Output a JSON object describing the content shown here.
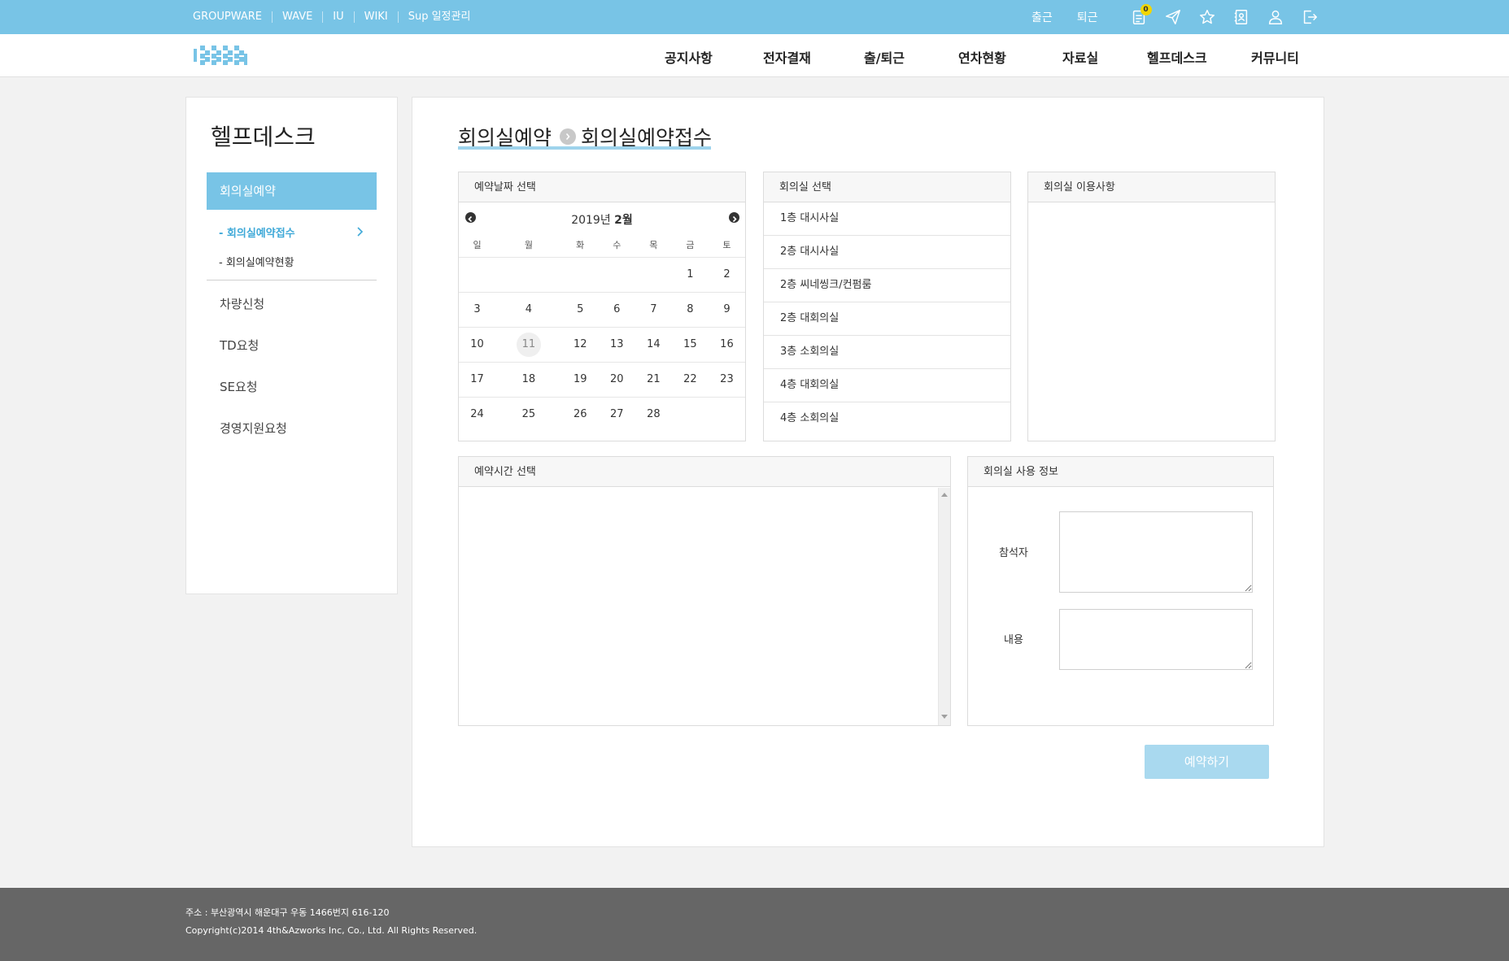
{
  "topbar": {
    "links": [
      "GROUPWARE",
      "WAVE",
      "IU",
      "WIKI",
      "Sup 일정관리"
    ],
    "checkin_label": "출근",
    "checkout_label": "퇴근",
    "notification_count": "0",
    "icons": [
      "clipboard-icon",
      "send-icon",
      "star-icon",
      "contacts-icon",
      "user-icon",
      "logout-icon"
    ],
    "bg_color": "#78c4e6"
  },
  "header": {
    "logo_alt": "logo",
    "nav": [
      "공지사항",
      "전자결재",
      "출/퇴근",
      "연차현황",
      "자료실",
      "헬프데스크",
      "커뮤니티"
    ]
  },
  "sidebar": {
    "title": "헬프데스크",
    "active_item": "회의실예약",
    "sub_items": [
      "- 회의실예약접수",
      "- 회의실예약현황"
    ],
    "items": [
      "차량신청",
      "TD요청",
      "SE요청",
      "경영지원요청"
    ]
  },
  "main": {
    "breadcrumb_parent": "회의실예약",
    "breadcrumb_current": "회의실예약접수",
    "date_panel_title": "예약날짜 선택",
    "room_panel_title": "회의실 선택",
    "notice_panel_title": "회의실 이용사항",
    "time_panel_title": "예약시간 선택",
    "info_panel_title": "회의실 사용 정보",
    "calendar": {
      "year_label": "2019년",
      "month_label": "2월",
      "weekdays": [
        "일",
        "월",
        "화",
        "수",
        "목",
        "금",
        "토"
      ],
      "weeks": [
        [
          "",
          "",
          "",
          "",
          "",
          "1",
          "2"
        ],
        [
          "3",
          "4",
          "5",
          "6",
          "7",
          "8",
          "9"
        ],
        [
          "10",
          "11",
          "12",
          "13",
          "14",
          "15",
          "16"
        ],
        [
          "17",
          "18",
          "19",
          "20",
          "21",
          "22",
          "23"
        ],
        [
          "24",
          "25",
          "26",
          "27",
          "28",
          "",
          ""
        ]
      ],
      "today": "11"
    },
    "rooms": [
      "1층 대시사실",
      "2층 대시사실",
      "2층 씨네씽크/컨펌룸",
      "2층 대회의실",
      "3층 소회의실",
      "4층 대회의실",
      "4층 소회의실"
    ],
    "info": {
      "attendee_label": "참석자",
      "content_label": "내용"
    },
    "reserve_button": "예약하기"
  },
  "footer": {
    "address": "주소 : 부산광역시 해운대구 우동 1466번지 616-120",
    "copyright": "Copyright(c)2014 4th&Azworks Inc, Co., Ltd. All Rights Reserved."
  }
}
